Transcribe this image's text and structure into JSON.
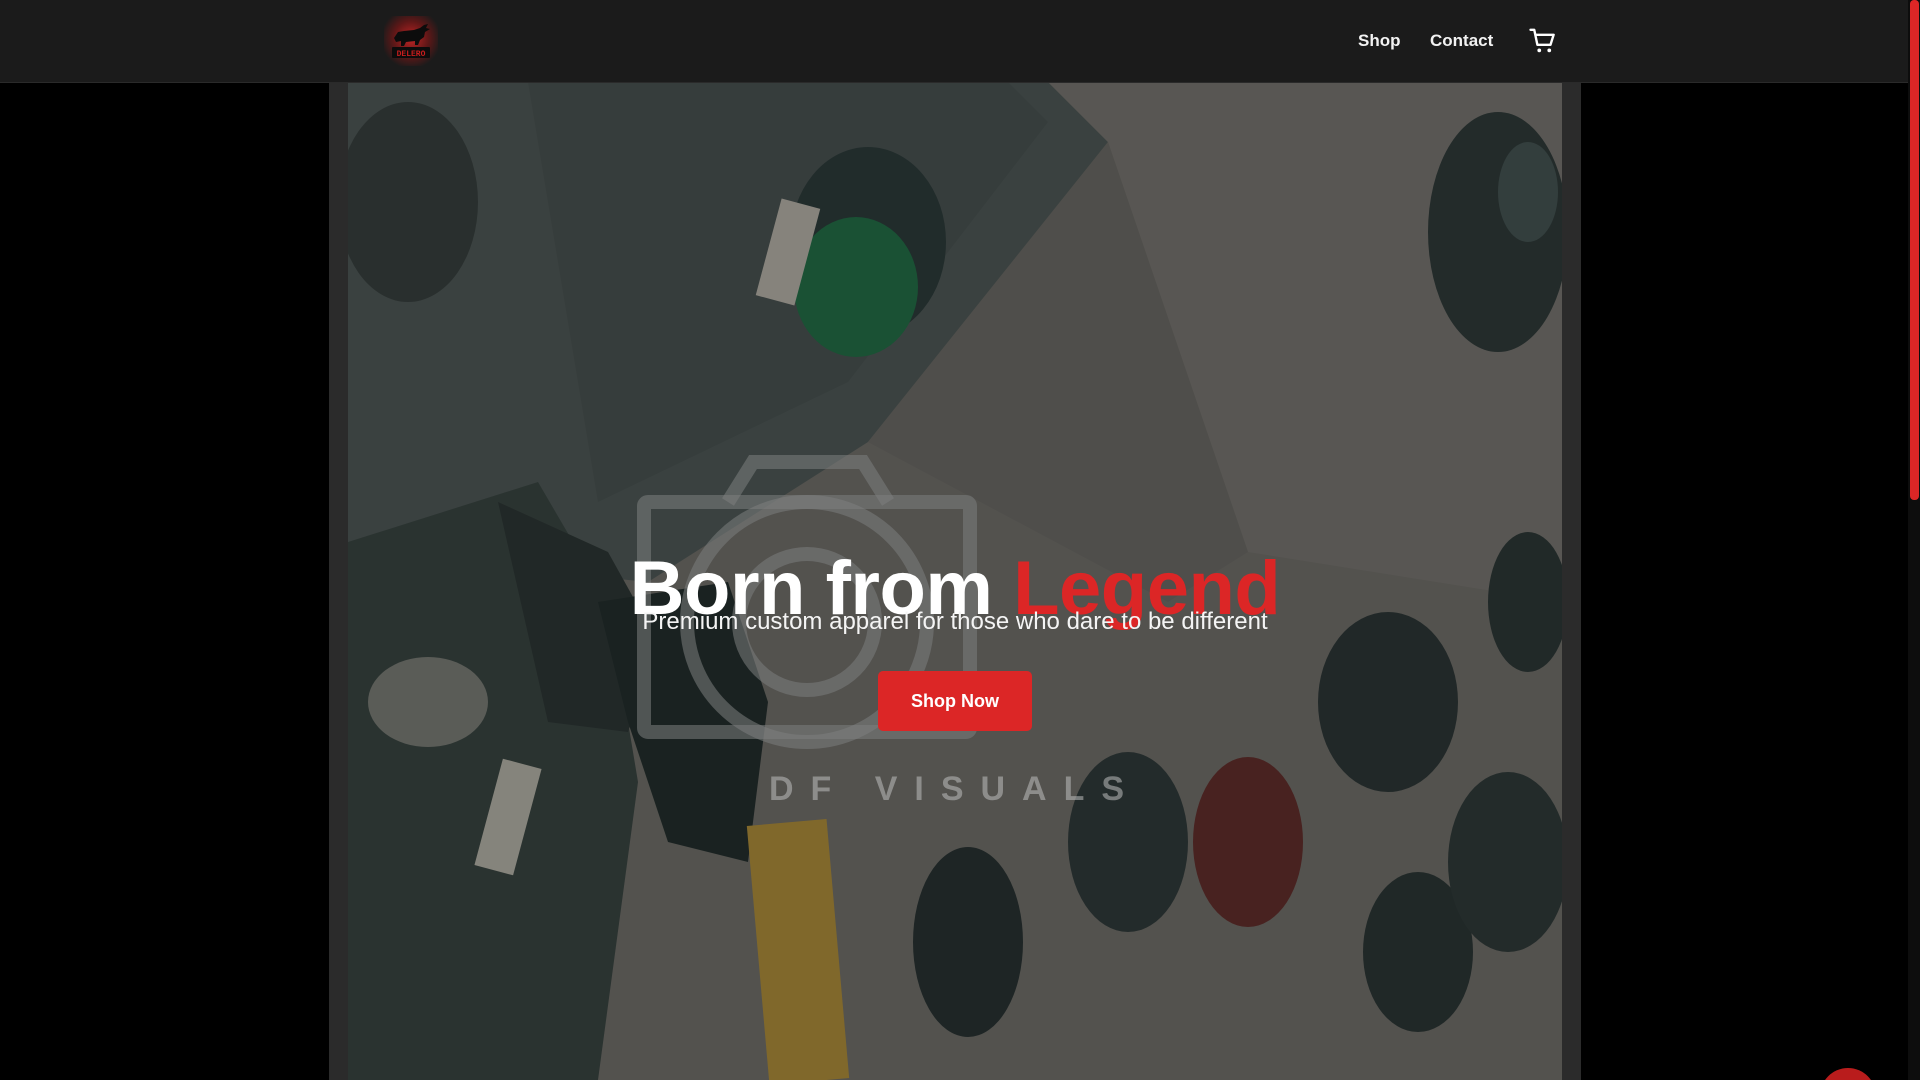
{
  "header": {
    "logo_text": "DELERO",
    "nav": [
      {
        "label": "Shop"
      },
      {
        "label": "Contact"
      }
    ],
    "cart_icon": "cart-icon"
  },
  "hero": {
    "title_main": "Born from",
    "title_accent": "Legend",
    "subtitle": "Premium custom apparel for those who dare to be different",
    "cta_label": "Shop Now",
    "watermark": "DF VISUALS"
  },
  "colors": {
    "accent": "#dc2626",
    "header_bg": "#1b1b1b",
    "page_bg": "#000000"
  }
}
